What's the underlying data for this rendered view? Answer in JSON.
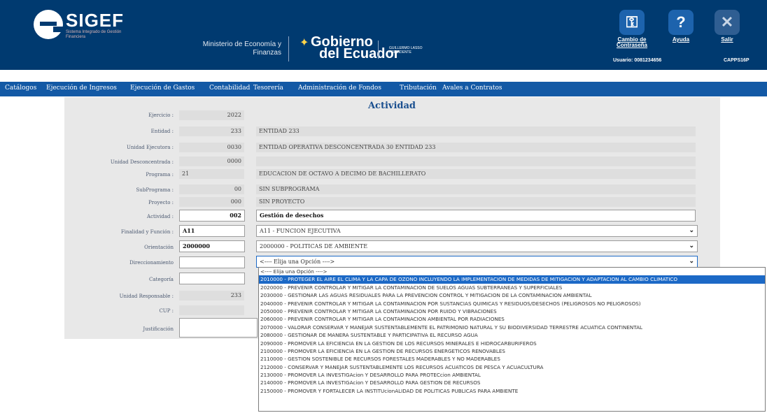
{
  "header": {
    "app_name": "SIGEF",
    "app_subtitle": "Sistema Integrado de Gestión Financiera",
    "ministry": "Ministerio de Economía y Finanzas",
    "gobierno_line1": "Gobierno",
    "gobierno_line2": "del Ecuador",
    "gobierno_tag": "GUILLERMO LASSO PRESIDENTE",
    "buttons": {
      "password": "Cambio de Contraseña",
      "help": "Ayuda",
      "exit": "Salir"
    },
    "usuario_label": "Usuario: 0081234656",
    "usuario_code": "CAPPS16P",
    "icons": {
      "password": "lock-icon",
      "help": "question-icon",
      "exit": "close-icon"
    }
  },
  "nav": [
    "Catálogos",
    "Ejecución de Ingresos",
    "Ejecución de Gastos",
    "Contabilidad",
    "Tesorería",
    "Administración de Fondos",
    "Tributación",
    "Avales a Contratos"
  ],
  "form": {
    "title": "Actividad",
    "ejercicio": {
      "label": "Ejercicio :",
      "value": "2022"
    },
    "entidad": {
      "label": "Entidad :",
      "code": "233",
      "name": "ENTIDAD 233"
    },
    "unidad_ejecutora": {
      "label": "Unidad Ejecutora :",
      "code": "0030",
      "name": "ENTIDAD OPERATIVA DESCONCENTRADA 30 ENTIDAD 233"
    },
    "unidad_desconcentrada": {
      "label": "Unidad Desconcentrada :",
      "code": "0000",
      "name": ""
    },
    "programa": {
      "label": "Programa :",
      "code": "21",
      "name": "EDUCACION DE OCTAVO A DECIMO DE BACHILLERATO"
    },
    "subprograma": {
      "label": "SubPrograma :",
      "code": "00",
      "name": "SIN SUBPROGRAMA"
    },
    "proyecto": {
      "label": "Proyecto :",
      "code": "000",
      "name": "SIN PROYECTO"
    },
    "actividad": {
      "label": "Actividad :",
      "code": "002",
      "name": "Gestión de desechos"
    },
    "finalidad": {
      "label": "Finalidad y Función :",
      "code": "A11",
      "selected": "A11 - FUNCION EJECUTIVA"
    },
    "orientacion": {
      "label": "Orientación",
      "code": "2000000",
      "selected": "2000000 - POLITICAS DE AMBIENTE"
    },
    "direccionamiento": {
      "label": "Direccionamiento",
      "code": "",
      "selected": "<---- Elija una Opción ---->"
    },
    "categoria": {
      "label": "Categoría",
      "code": ""
    },
    "unidad_responsable": {
      "label": "Unidad Responsable :",
      "code": "233"
    },
    "cup": {
      "label": "CUP :",
      "code": ""
    },
    "justificacion": {
      "label": "Justificación",
      "value": ""
    }
  },
  "dropdown": {
    "selected_index": 1,
    "options": [
      "<---- Elija una Opción ---->",
      "2010000 - PROTEGER EL AIRE EL CLIMA Y LA CAPA DE OZONO INCLUYENDO LA IMPLEMENTACION DE MEDIDAS DE MITIGACION Y ADAPTACION AL CAMBIO CLIMATICO",
      "2020000 - PREVENIR CONTROLAR Y MITIGAR LA CONTAMINACION DE SUELOS AGUAS SUBTERRANEAS Y SUPERFICIALES",
      "2030000 - GESTIONAR LAS AGUAS RESIDUALES PARA LA PREVENCION CONTROL Y MITIGACION DE LA CONTAMINACION AMBIENTAL",
      "2040000 - PREVENIR CONTROLAR Y MITIGAR LA CONTAMINACION POR SUSTANCIAS QUIMICAS Y RESIDUOS/DESECHOS (PELIGROSOS NO PELIGROSOS)",
      "2050000 - PREVENIR CONTROLAR Y MITIGAR LA CONTAMINACION POR RUIDO Y VIBRACIONES",
      "2060000 - PREVENIR CONTROLAR Y MITIGAR LA CONTAMINACION AMBIENTAL POR RADIACIONES",
      "2070000 - VALORAR CONSERVAR Y MANEJAR SUSTENTABLEMENTE EL PATRIMONIO NATURAL Y SU BIODIVERSIDAD TERRESTRE ACUATICA CONTINENTAL",
      "2080000 - GESTIONAR DE MANERA SUSTENTABLE Y PARTICIPATIVA EL RECURSO AGUA",
      "2090000 - PROMOVER LA EFICIENCIA EN LA GESTION DE LOS RECURSOS MINERALES E HIDROCARBURIFEROS",
      "2100000 - PROMOVER LA EFICIENCIA EN LA GESTION DE RECURSOS ENERGETICOS RENOVABLES",
      "2110000 - GESTION SOSTENIBLE DE RECURSOS FORESTALES MADERABLES Y NO MADERABLES",
      "2120000 - CONSERVAR Y MANEJAR SUSTENTABLEMENTE LOS RECURSOS ACUATICOS DE PESCA Y ACUACULTURA",
      "2130000 - PROMOVER LA INVESTIGAcion Y DESARROLLO PARA PROTECcion AMBIENTAL",
      "2140000 - PROMOVER LA INVESTIGAcion Y DESARROLLO PARA GESTION DE RECURSOS",
      "2150000 - PROMOVER Y FORTALECER LA INSTITUcionALIDAD DE POLITICAS PUBLICAS PARA AMBIENTE"
    ]
  },
  "colors": {
    "header_bg": "#003a70",
    "nav_bg": "#1359a5",
    "selected_option": "#1c69c6",
    "title": "#1a4f8f"
  }
}
